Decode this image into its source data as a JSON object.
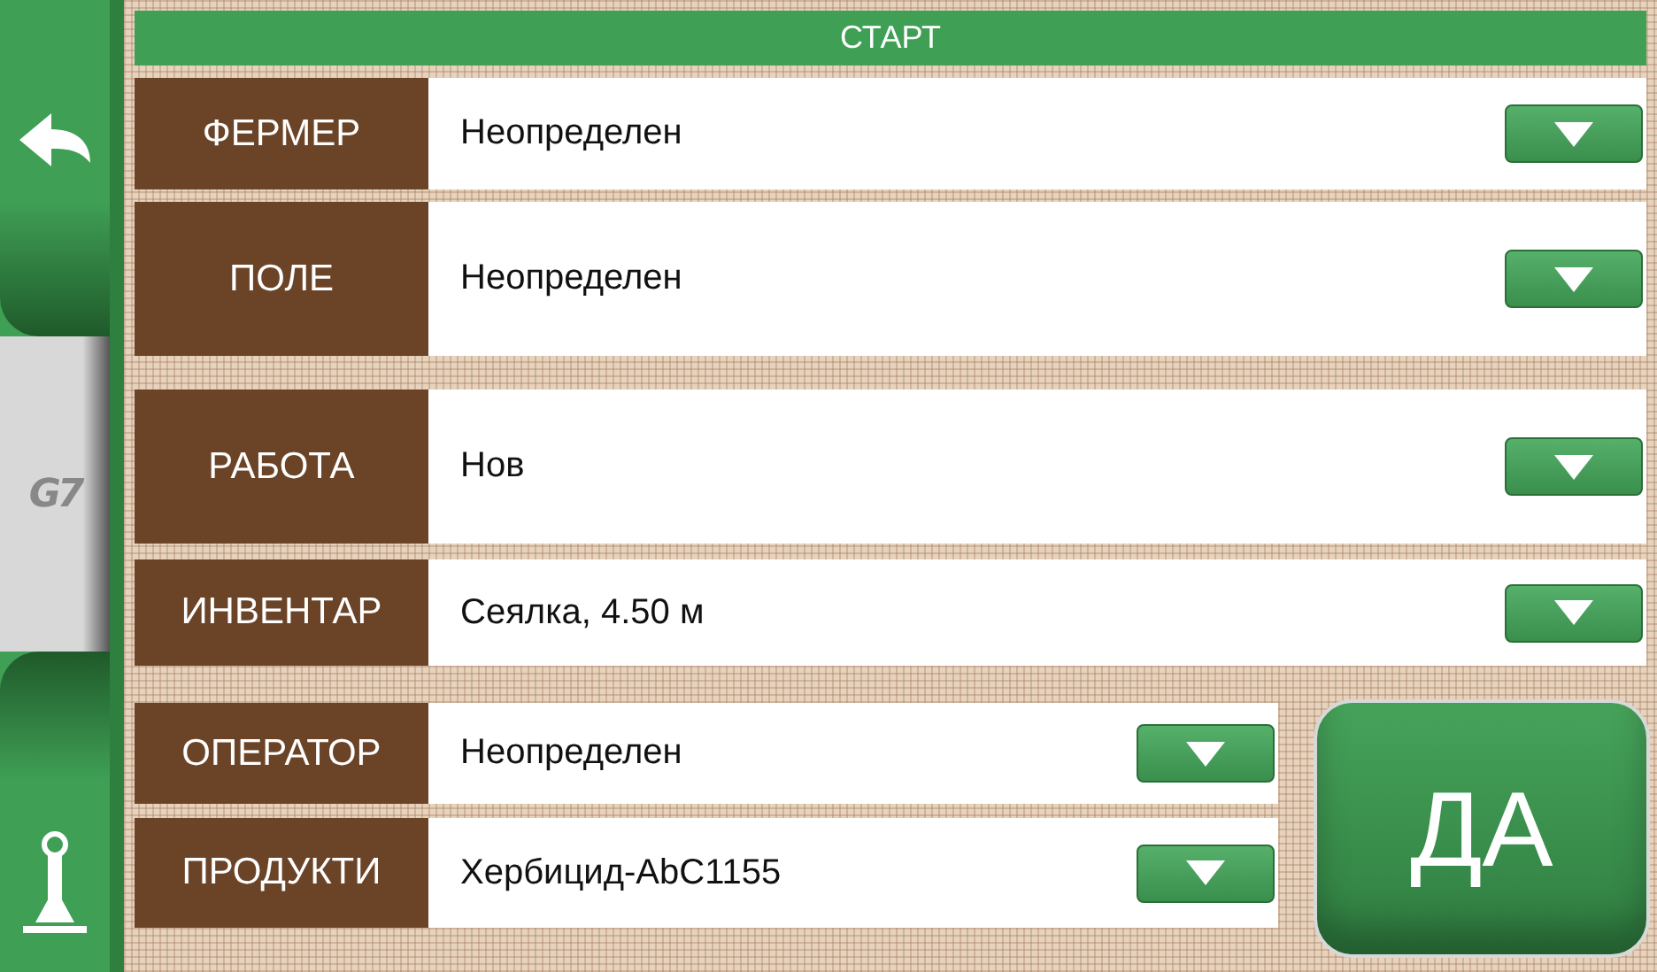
{
  "sidebar": {
    "logo": "G7"
  },
  "header": {
    "title": "СТАРТ"
  },
  "rows": [
    {
      "label": "ФЕРМЕР",
      "value": "Неопределен"
    },
    {
      "label": "ПОЛЕ",
      "value": "Неопределен"
    },
    {
      "label": "РАБОТА",
      "value": "Нов"
    },
    {
      "label": "ИНВЕНТАР",
      "value": "Сеялка, 4.50 м"
    }
  ],
  "bottom_rows": [
    {
      "label": "ОПЕРАТОР",
      "value": "Неопределен"
    },
    {
      "label": "ПРОДУКТИ",
      "value": "Хербицид-AbC1155"
    }
  ],
  "confirm_button": {
    "label": "ДА"
  }
}
